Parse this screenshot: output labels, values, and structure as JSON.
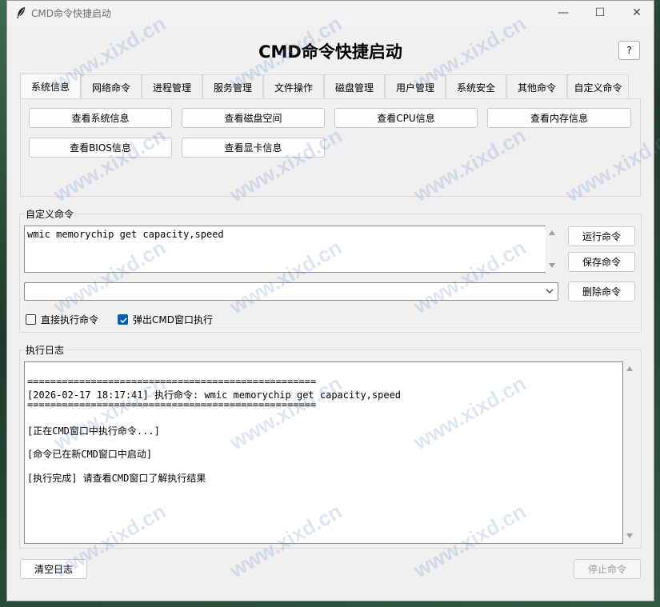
{
  "window": {
    "title": "CMD命令快捷启动",
    "heading": "CMD命令快捷启动",
    "help_label": "?",
    "controls": {
      "minimize": "—",
      "maximize": "☐",
      "close": "✕"
    }
  },
  "tabs": [
    {
      "label": "系统信息",
      "active": true
    },
    {
      "label": "网络命令"
    },
    {
      "label": "进程管理"
    },
    {
      "label": "服务管理"
    },
    {
      "label": "文件操作"
    },
    {
      "label": "磁盘管理"
    },
    {
      "label": "用户管理"
    },
    {
      "label": "系统安全"
    },
    {
      "label": "其他命令"
    },
    {
      "label": "自定义命令"
    }
  ],
  "system_info_buttons": [
    "查看系统信息",
    "查看磁盘空间",
    "查看CPU信息",
    "查看内存信息",
    "查看BIOS信息",
    "查看显卡信息"
  ],
  "custom": {
    "group_label": "自定义命令",
    "command_text": "wmic memorychip get capacity,speed",
    "run_label": "运行命令",
    "save_label": "保存命令",
    "delete_label": "删除命令",
    "combo_value": "",
    "direct_exec": {
      "label": "直接执行命令",
      "checked": false
    },
    "popup_cmd": {
      "label": "弹出CMD窗口执行",
      "checked": true
    }
  },
  "log": {
    "group_label": "执行日志",
    "lines": [
      "==================================================",
      "[2026-02-17 18:17:41] 执行命令: wmic memorychip get capacity,speed",
      "==================================================",
      "[正在CMD窗口中执行命令...]",
      "[命令已在新CMD窗口中启动]",
      "[执行完成] 请查看CMD窗口了解执行结果"
    ]
  },
  "footer": {
    "clear_label": "清空日志",
    "stop_label": "停止命令"
  },
  "watermark": "www.xixd.cn",
  "colors": {
    "accent": "#005fb8",
    "window_bg": "#f0f0f0",
    "disabled_text": "#9a9a9a"
  }
}
